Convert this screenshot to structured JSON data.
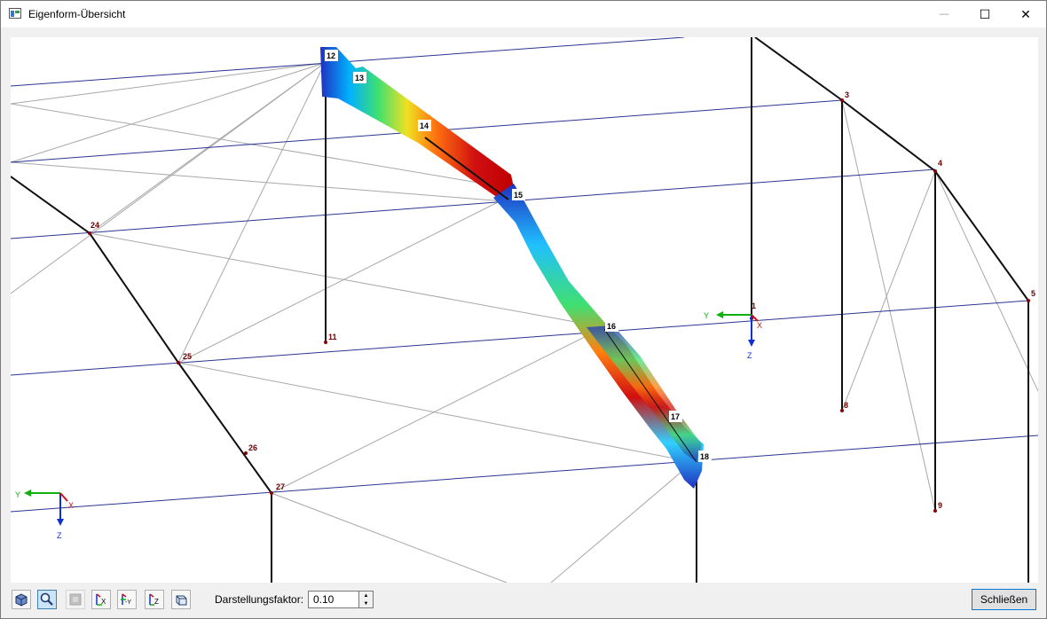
{
  "window": {
    "title": "Eigenform-Übersicht"
  },
  "controls": {
    "minimize": "—",
    "maximize": "☐",
    "close": "✕"
  },
  "toolbar": {
    "buttons": [
      {
        "name": "view-3d-button",
        "icon": "cube-icon",
        "active": false
      },
      {
        "name": "zoom-button",
        "icon": "magnifier-icon",
        "active": true
      },
      {
        "name": "render-button",
        "icon": "render-icon",
        "active": false,
        "disabled": true
      },
      {
        "name": "view-x-button",
        "icon": "view-x-icon",
        "label": "X"
      },
      {
        "name": "view-minus-y-button",
        "icon": "view-minus-y-icon",
        "label": "-Y"
      },
      {
        "name": "view-z-button",
        "icon": "view-z-icon",
        "label": "Z"
      },
      {
        "name": "isometric-button",
        "icon": "isometric-icon"
      }
    ],
    "factor_label": "Darstellungsfaktor:",
    "factor_value": "0.10",
    "close_label": "Schließen"
  },
  "viewport": {
    "nodes": [
      "1",
      "3",
      "4",
      "5",
      "8",
      "9",
      "11",
      "12",
      "13",
      "14",
      "15",
      "16",
      "17",
      "18",
      "24",
      "25",
      "26",
      "27"
    ],
    "axes_main": {
      "y": "Y",
      "x": "X",
      "z": "Z"
    },
    "axes_corner": {
      "y": "Y",
      "x": "X",
      "z": "Z"
    }
  }
}
